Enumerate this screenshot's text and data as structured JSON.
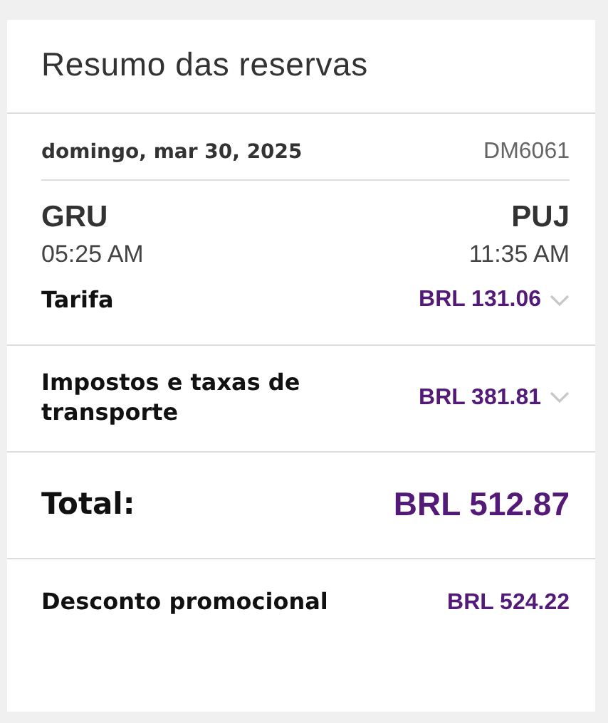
{
  "title": "Resumo das reservas",
  "flight": {
    "date": "domingo, mar 30, 2025",
    "number": "DM6061",
    "origin": {
      "code": "GRU",
      "time": "05:25 AM"
    },
    "destination": {
      "code": "PUJ",
      "time": "11:35 AM"
    }
  },
  "lines": [
    {
      "kind": "expandable",
      "label": "Tarifa",
      "amount": "BRL 131.06",
      "expanded": false
    },
    {
      "kind": "expandable",
      "label": "Impostos e taxas de transporte",
      "amount": "BRL 381.81",
      "expanded": false
    },
    {
      "kind": "total",
      "label": "Total:",
      "amount": "BRL 512.87"
    },
    {
      "kind": "plain",
      "label": "Desconto promocional",
      "amount": "BRL 524.22"
    }
  ]
}
